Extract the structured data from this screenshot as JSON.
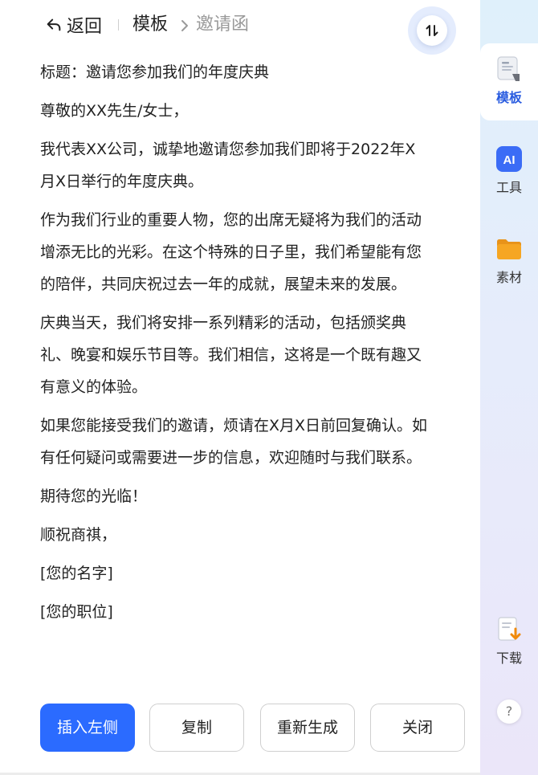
{
  "header": {
    "back_label": "返回",
    "breadcrumb": [
      "模板",
      "邀请函"
    ]
  },
  "letter": {
    "paragraphs": [
      "标题：邀请您参加我们的年度庆典",
      "尊敬的XX先生/女士，",
      "我代表XX公司，诚挚地邀请您参加我们即将于2022年X月X日举行的年度庆典。",
      "作为我们行业的重要人物，您的出席无疑将为我们的活动增添无比的光彩。在这个特殊的日子里，我们希望能有您的陪伴，共同庆祝过去一年的成就，展望未来的发展。",
      "庆典当天，我们将安排一系列精彩的活动，包括颁奖典礼、晚宴和娱乐节目等。我们相信，这将是一个既有趣又有意义的体验。",
      "如果您能接受我们的邀请，烦请在X月X日前回复确认。如有任何疑问或需要进一步的信息，欢迎随时与我们联系。",
      "期待您的光临！",
      "顺祝商祺，",
      "[您的名字]",
      "[您的职位]"
    ]
  },
  "actions": {
    "insert_left": "插入左侧",
    "copy": "复制",
    "regenerate": "重新生成",
    "close": "关闭"
  },
  "sidebar": {
    "items": [
      {
        "label": "模板",
        "icon": "template-icon",
        "active": true
      },
      {
        "label": "工具",
        "icon": "ai-tools-icon",
        "active": false
      },
      {
        "label": "素材",
        "icon": "folder-icon",
        "active": false
      },
      {
        "label": "下载",
        "icon": "download-icon",
        "active": false
      }
    ],
    "help_label": "?"
  },
  "colors": {
    "primary": "#2b6bff",
    "active_label": "#2b5de0",
    "ai_icon": "#3b6cf6",
    "folder_icon": "#f6a623",
    "download_arrow": "#f08a0c"
  }
}
